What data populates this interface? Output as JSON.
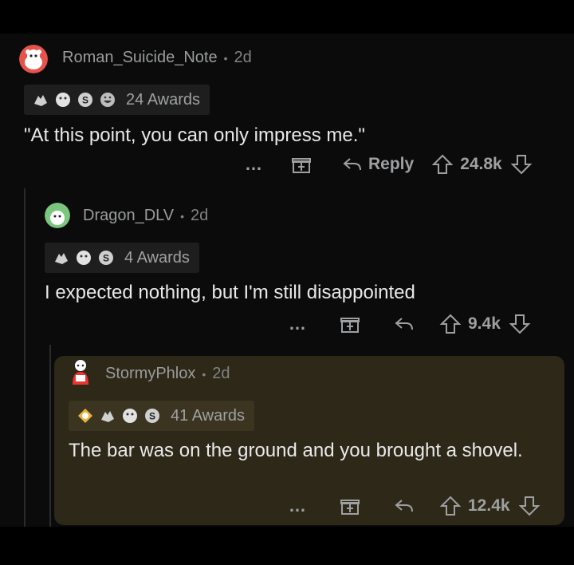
{
  "comments": [
    {
      "username": "Roman_Suicide_Note",
      "age": "2d",
      "awards_label": "24 Awards",
      "text": "\"At this point, you can only impress me.\"",
      "reply_label": "Reply",
      "score": "24.8k"
    },
    {
      "username": "Dragon_DLV",
      "age": "2d",
      "awards_label": "4 Awards",
      "text": "I expected nothing, but I'm still disappointed",
      "score": "9.4k"
    },
    {
      "username": "StormyPhlox",
      "age": "2d",
      "awards_label": "41 Awards",
      "text": "The bar was on the ground and you brought a shovel.",
      "score": "12.4k"
    }
  ],
  "icons": {
    "more": "…",
    "gift": "gift-icon",
    "reply": "reply-icon",
    "upvote": "upvote-icon",
    "downvote": "downvote-icon"
  },
  "colors": {
    "background": "#0b0b0b",
    "highlight": "#2d2817",
    "text": "#e8e9ea",
    "muted": "#818384"
  }
}
